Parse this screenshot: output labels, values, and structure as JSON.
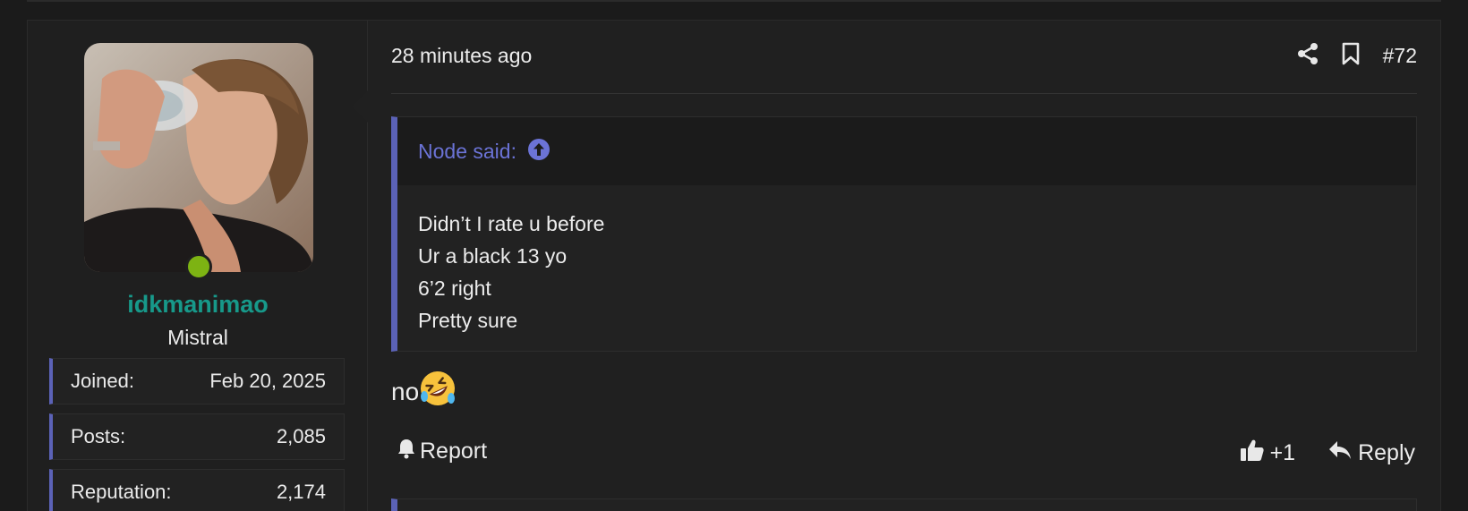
{
  "post": {
    "timestamp": "28 minutes ago",
    "post_number": "#72",
    "header_icons": [
      "share-icon",
      "bookmark-icon"
    ]
  },
  "user": {
    "username": "idkmanimao",
    "title": "Mistral",
    "online": true,
    "stats": [
      {
        "label": "Joined:",
        "value": "Feb 20, 2025"
      },
      {
        "label": "Posts:",
        "value": "2,085"
      },
      {
        "label": "Reputation:",
        "value": "2,174"
      }
    ]
  },
  "quote": {
    "author_label": "Node said:",
    "lines": [
      "Didn’t I rate u before",
      "Ur a black 13 yo",
      "6’2 right",
      "Pretty sure"
    ]
  },
  "message": {
    "text": "no",
    "emoji": "🤣"
  },
  "footer": {
    "report_label": "Report",
    "reaction_count": "+1",
    "reply_label": "Reply"
  },
  "colors": {
    "accent": "#5b62b7",
    "username": "#17998a",
    "online": "#7db313",
    "quote_author": "#6b73d6"
  }
}
